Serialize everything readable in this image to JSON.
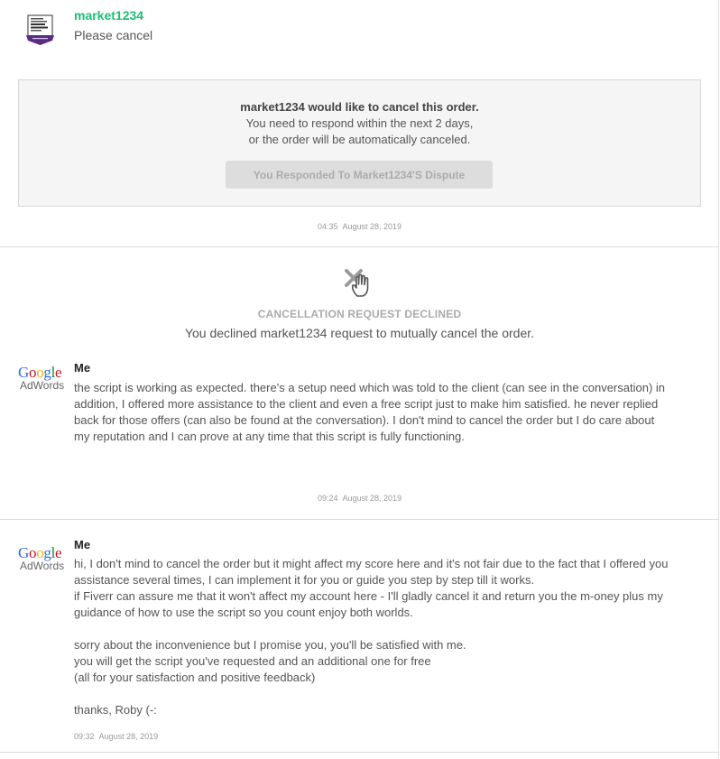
{
  "message1": {
    "sender": "market1234",
    "text": "Please cancel"
  },
  "cancel_request": {
    "title": "market1234 would like to cancel this order.",
    "line1": "You need to respond within the next 2 days,",
    "line2": "or the order will be automatically canceled.",
    "button_label": "You Responded To Market1234'S Dispute",
    "time": "04:35",
    "date": "August 28, 2019"
  },
  "declined": {
    "title": "CANCELLATION REQUEST DECLINED",
    "description": "You declined market1234 request to mutually cancel the order."
  },
  "message2": {
    "sender": "Me",
    "logo_google": "Google",
    "logo_adwords": "AdWords",
    "text": "the script is working as expected. there's a setup need which was told to the client (can see in the conversation) in addition, I offered more assistance to the client and even a free script just to make him satisfied. he never replied back for those offers (can also be found at the conversation). I don't mind to cancel the order but I do care about my reputation and I can prove at any time that this script is fully functioning.",
    "time": "09:24",
    "date": "August 28, 2019"
  },
  "message3": {
    "sender": "Me",
    "logo_google": "Google",
    "logo_adwords": "AdWords",
    "lines": [
      "hi, I don't mind to cancel the order but it might affect my score here and it's not fair due to the fact that I offered you assistance several times, I can implement it for you or guide you step by step till it works.",
      "if Fiverr can assure me that it won't affect my account here - I'll gladly cancel it and return you the m-oney plus my guidance of how to use the script so you count enjoy both worlds.",
      "",
      "sorry about the inconvenience but I promise you, you'll be satisfied with me.",
      "you will get the script you've requested and an additional one for free",
      "(all for your satisfaction and positive feedback)",
      "",
      "thanks, Roby (-:"
    ],
    "time": "09:32",
    "date": "August 28, 2019"
  },
  "colors": {
    "brand_green": "#1dbf73",
    "badge_purple": "#5a2d82",
    "google_blue": "#3369e8",
    "google_red": "#d50f25",
    "google_yellow": "#eeb211",
    "google_green": "#009925"
  },
  "icons": {
    "avatar": "award-badge-icon",
    "declined": "hand-x-icon"
  }
}
